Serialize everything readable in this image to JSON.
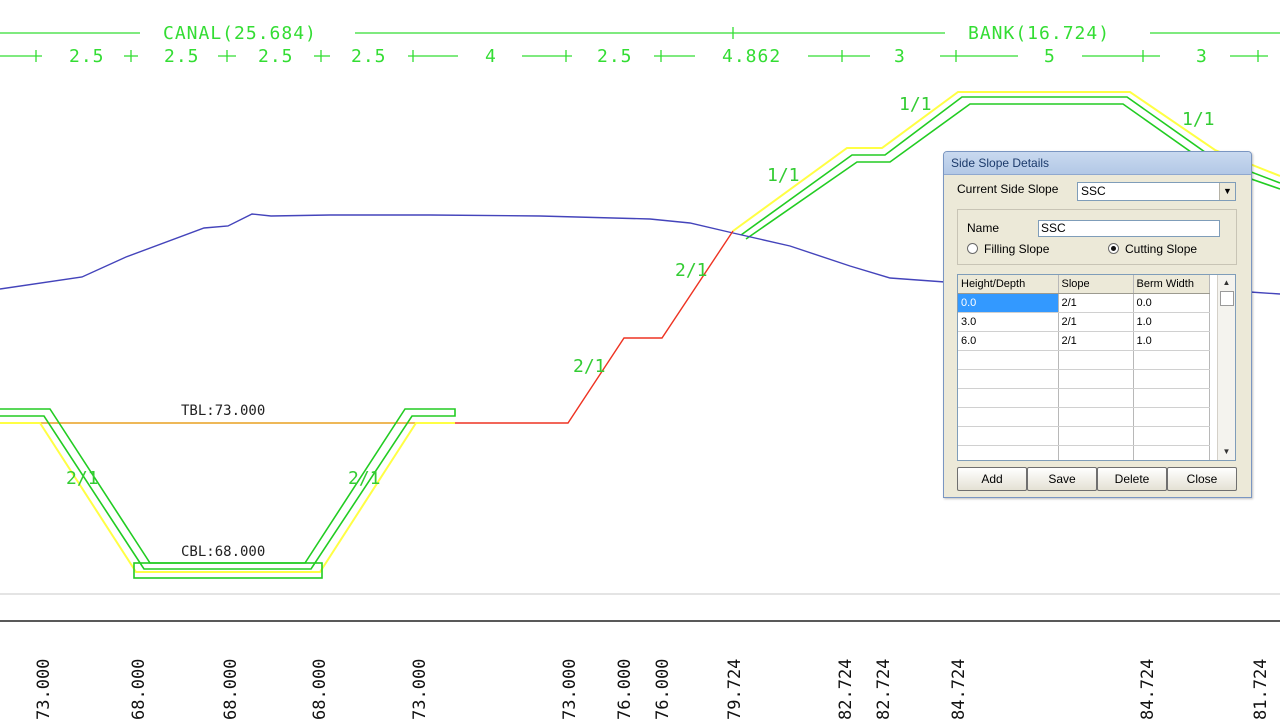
{
  "dimensions": {
    "canal_label": "CANAL(25.684)",
    "bank_label": "BANK(16.724)",
    "segments": [
      "2.5",
      "2.5",
      "2.5",
      "2.5",
      "4",
      "2.5",
      "4.862",
      "3",
      "5",
      "3"
    ]
  },
  "levels": {
    "tbl_label": "TBL:73.000",
    "cbl_label": "CBL:68.000"
  },
  "slope_labels": {
    "left_canal": "2/1",
    "right_canal": "2/1",
    "cut_lower": "2/1",
    "cut_upper": "2/1",
    "bank_fill_lower": "1/1",
    "bank_fill_upper": "1/1",
    "bank_right": "1/1"
  },
  "elevations": [
    "73.000",
    "68.000",
    "68.000",
    "68.000",
    "73.000",
    "73.000",
    "76.000",
    "76.000",
    "79.724",
    "82.724",
    "82.724",
    "84.724",
    "84.724",
    "81.724"
  ],
  "colors": {
    "dim": "#33dd33",
    "ground_line": "#4444bb",
    "design_line": "#ee3322",
    "outline_green": "#22cc22",
    "outline_yellow": "#ffff44"
  },
  "dialog": {
    "title": "Side Slope Details",
    "current_label": "Current Side Slope",
    "current_value": "SSC",
    "name_label": "Name",
    "name_value": "SSC",
    "filling_label": "Filling Slope",
    "cutting_label": "Cutting Slope",
    "selected_slope_type": "Cutting Slope",
    "columns": [
      "Height/Depth",
      "Slope",
      "Berm Width"
    ],
    "rows": [
      [
        "0.0",
        "2/1",
        "0.0"
      ],
      [
        "3.0",
        "2/1",
        "1.0"
      ],
      [
        "6.0",
        "2/1",
        "1.0"
      ]
    ],
    "buttons": {
      "add": "Add",
      "save": "Save",
      "delete": "Delete",
      "close": "Close"
    }
  }
}
